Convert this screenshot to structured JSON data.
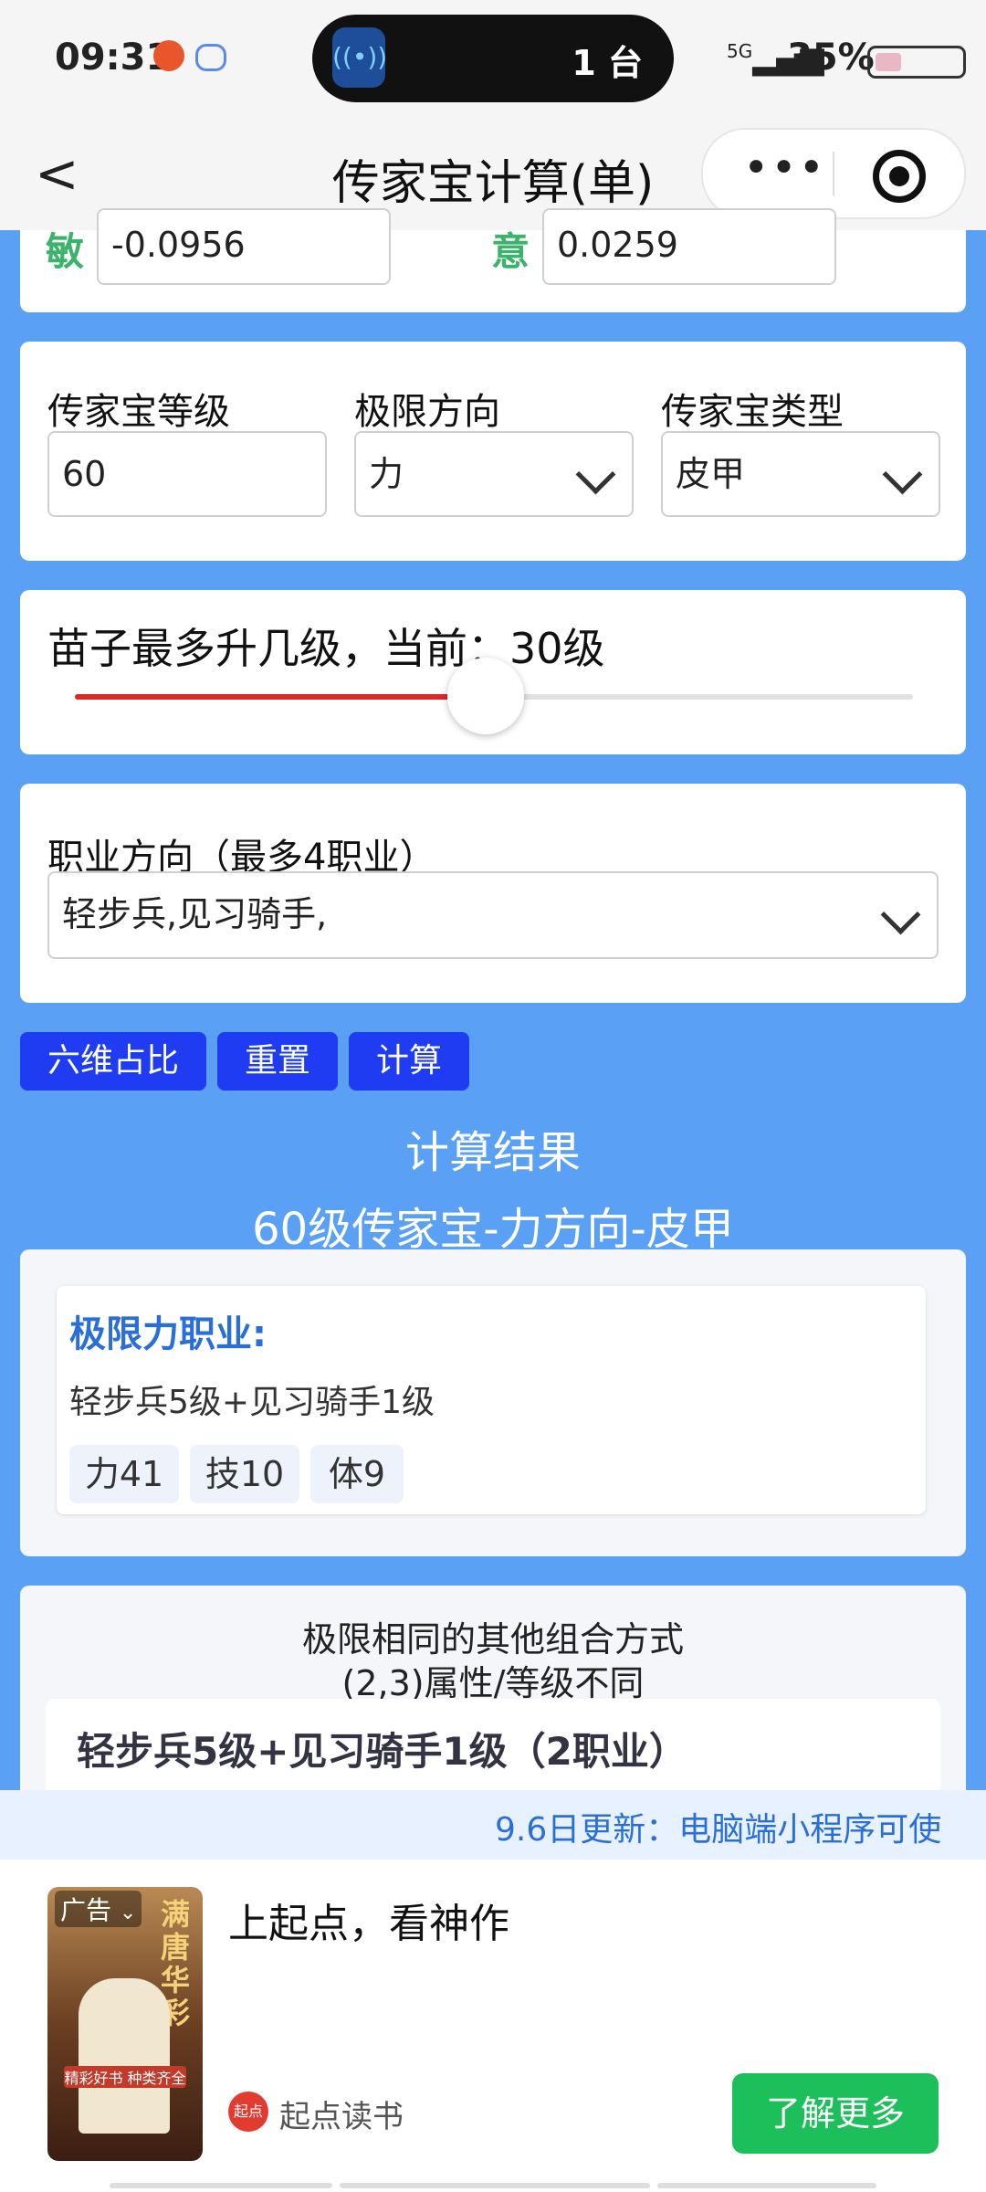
{
  "status": {
    "time": "09:31",
    "island_count": "1 台",
    "network": "5G",
    "battery": "35%"
  },
  "nav": {
    "back": "<",
    "title": "传家宝计算(单)",
    "more": "•••"
  },
  "ratio": {
    "min_label": "敏",
    "min_value": "-0.0956",
    "yi_label": "意",
    "yi_value": "0.0259"
  },
  "settings": {
    "level_label": "传家宝等级",
    "level_value": "60",
    "direction_label": "极限方向",
    "direction_value": "力",
    "type_label": "传家宝类型",
    "type_value": "皮甲"
  },
  "slider": {
    "label": "苗子最多升几级，当前：30级",
    "fill_fraction": 0.49
  },
  "profession": {
    "label": "职业方向（最多4职业）",
    "value": "轻步兵,见习骑手,"
  },
  "buttons": {
    "ratio": "六维占比",
    "reset": "重置",
    "calc": "计算"
  },
  "result": {
    "title": "计算结果",
    "subtitle": "60级传家宝-力方向-皮甲",
    "extreme_title": "极限力职业:",
    "extreme_combo": "轻步兵5级+见习骑手1级",
    "tags": [
      "力41",
      "技10",
      "体9"
    ]
  },
  "others": {
    "title_line1": "极限相同的其他组合方式",
    "title_line2": "(2,3)属性/等级不同",
    "first_item": "轻步兵5级+见习骑手1级（2职业）"
  },
  "marquee": "9.6日更新：电脑端小程序可使",
  "ad": {
    "badge": "广告",
    "headline": "上起点，看神作",
    "brand": "起点读书",
    "brand_logo": "起点",
    "cta": "了解更多",
    "poster_text": "满唐华彩",
    "poster_sub": "精彩好书 种类齐全"
  },
  "colors": {
    "page_bg": "#5aa0f5",
    "button_blue": "#1f3cf2",
    "slider_red": "#d92a2a",
    "cta_green": "#1dbf5a",
    "accent_blue": "#2a6fd8"
  }
}
